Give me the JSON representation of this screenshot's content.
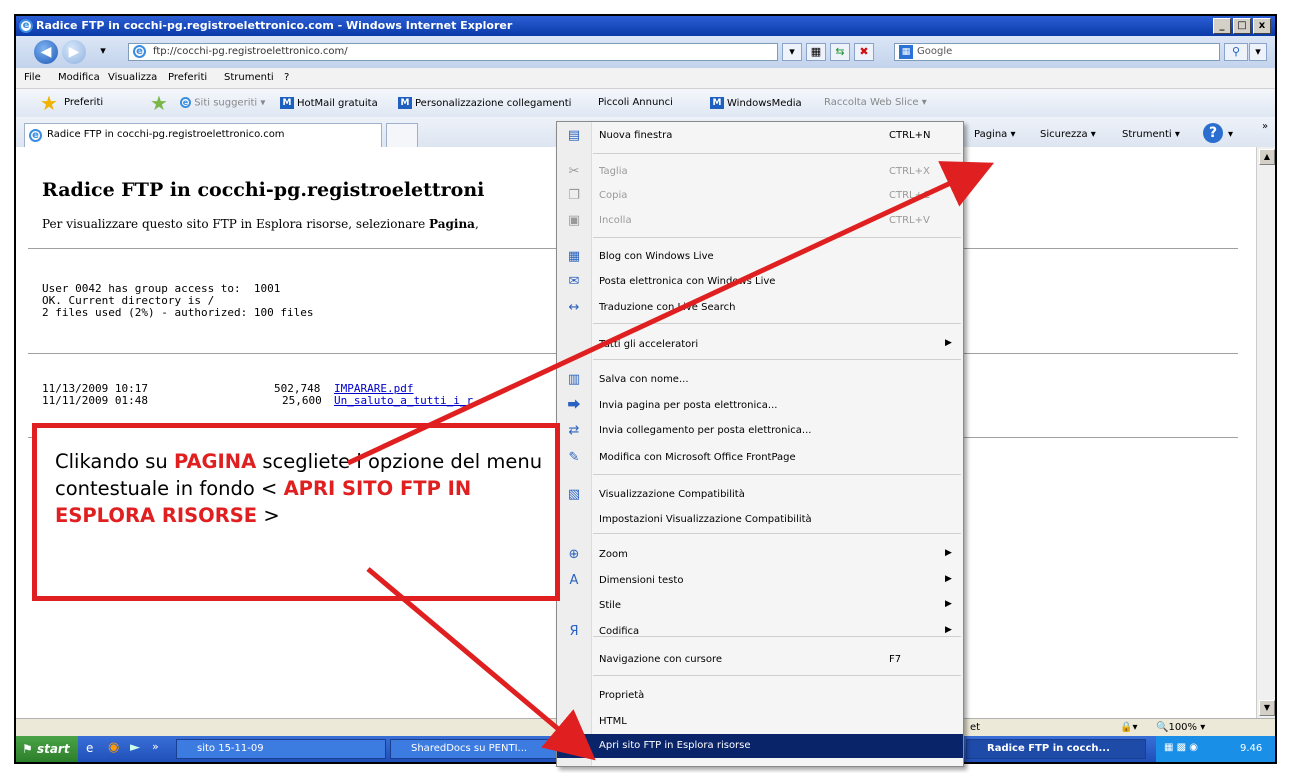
{
  "window": {
    "title": "Radice FTP in cocchi-pg.registroelettronico.com - Windows Internet Explorer",
    "min": "_",
    "max": "□",
    "close": "x"
  },
  "address": {
    "url": "ftp://cocchi-pg.registroelettronico.com/",
    "search_label": "Google"
  },
  "menubar": [
    "File",
    "Modifica",
    "Visualizza",
    "Preferiti",
    "Strumenti",
    "?"
  ],
  "favbar": {
    "favorites": "Preferiti",
    "links": [
      "Siti suggeriti ▾",
      "HotMail gratuita",
      "Personalizzazione collegamenti",
      "Piccoli Annunci",
      "WindowsMedia",
      "Raccolta Web Slice ▾"
    ]
  },
  "tab": {
    "title": "Radice FTP in cocchi-pg.registroelettronico.com"
  },
  "commandbar": {
    "pagina": "Pagina ▾",
    "sicurezza": "Sicurezza ▾",
    "strumenti": "Strumenti ▾",
    "more": "»"
  },
  "page": {
    "title": "Radice FTP in cocchi-pg.registroelettroni",
    "info_prefix": "Per visualizzare questo sito FTP in Esplora risorse, selezionare ",
    "info_bold": "Pagina",
    "info_suffix": ",",
    "msg1": "User 0042 has group access to:  1001",
    "msg2": "OK. Current directory is /",
    "msg3": "2 files used (2%) - authorized: 100 files",
    "files": [
      {
        "date": "11/13/2009 10:17",
        "size": "502,748",
        "name": "IMPARARE.pdf"
      },
      {
        "date": "11/11/2009 01:48",
        "size": "25,600",
        "name": "Un_saluto_a_tutti_i_r"
      }
    ]
  },
  "context_menu": {
    "items": [
      {
        "label": "Nuova finestra",
        "shortcut": "CTRL+N",
        "icon": "window-icon",
        "disabled": false
      },
      {
        "label": "Taglia",
        "shortcut": "CTRL+X",
        "icon": "scissors-icon",
        "disabled": true
      },
      {
        "label": "Copia",
        "shortcut": "CTRL+C",
        "icon": "copy-icon",
        "disabled": true
      },
      {
        "label": "Incolla",
        "shortcut": "CTRL+V",
        "icon": "paste-icon",
        "disabled": true
      },
      {
        "label": "Blog con Windows Live",
        "shortcut": "",
        "icon": "blog-icon",
        "disabled": false
      },
      {
        "label": "Posta elettronica con Windows Live",
        "shortcut": "",
        "icon": "mail-icon",
        "disabled": false
      },
      {
        "label": "Traduzione con Live Search",
        "shortcut": "",
        "icon": "translate-icon",
        "disabled": false
      },
      {
        "label": "Tutti gli acceleratori",
        "shortcut": "",
        "icon": "",
        "disabled": false,
        "submenu": true
      },
      {
        "label": "Salva con nome...",
        "shortcut": "",
        "icon": "save-icon",
        "disabled": false
      },
      {
        "label": "Invia pagina per posta elettronica...",
        "shortcut": "",
        "icon": "send-page-icon",
        "disabled": false
      },
      {
        "label": "Invia collegamento per posta elettronica...",
        "shortcut": "",
        "icon": "send-link-icon",
        "disabled": false
      },
      {
        "label": "Modifica con Microsoft Office FrontPage",
        "shortcut": "",
        "icon": "edit-pencil-icon",
        "disabled": false
      },
      {
        "label": "Visualizzazione Compatibilità",
        "shortcut": "",
        "icon": "compat-icon",
        "disabled": false
      },
      {
        "label": "Impostazioni Visualizzazione Compatibilità",
        "shortcut": "",
        "icon": "",
        "disabled": false
      },
      {
        "label": "Zoom",
        "shortcut": "",
        "icon": "zoom-icon",
        "disabled": false,
        "submenu": true
      },
      {
        "label": "Dimensioni testo",
        "shortcut": "",
        "icon": "text-size-icon",
        "disabled": false,
        "submenu": true
      },
      {
        "label": "Stile",
        "shortcut": "",
        "icon": "",
        "disabled": false,
        "submenu": true
      },
      {
        "label": "Codifica",
        "shortcut": "",
        "icon": "encoding-icon",
        "disabled": false,
        "submenu": true
      },
      {
        "label": "Navigazione con cursore",
        "shortcut": "F7",
        "icon": "",
        "disabled": false
      },
      {
        "label": "Proprietà",
        "shortcut": "",
        "icon": "",
        "disabled": false
      },
      {
        "label": "HTML",
        "shortcut": "",
        "icon": "html-icon",
        "disabled": false
      },
      {
        "label": "Apri sito FTP in Esplora risorse",
        "shortcut": "",
        "icon": "",
        "disabled": false,
        "highlighted": true
      }
    ]
  },
  "callout": {
    "p1": "Clikando su ",
    "p1_red": "PAGINA",
    "p2": "  scegliete l’opzione del  menu contestuale in fondo < ",
    "p2_red": "APRI SITO FTP IN ESPLORA RISORSE",
    "p3": " >"
  },
  "statusbar": {
    "zone": "et",
    "zoom": "🔍100%  ▾"
  },
  "taskbar": {
    "start": "start",
    "items": [
      "sito 15-11-09",
      "SharedDocs su PENTI...",
      "Radice FTP in cocch..."
    ],
    "clock": "9.46"
  },
  "colors": {
    "accent_red": "#e02020",
    "menu_highlight": "#0a246a",
    "title_blue": "#0a3aa8"
  }
}
